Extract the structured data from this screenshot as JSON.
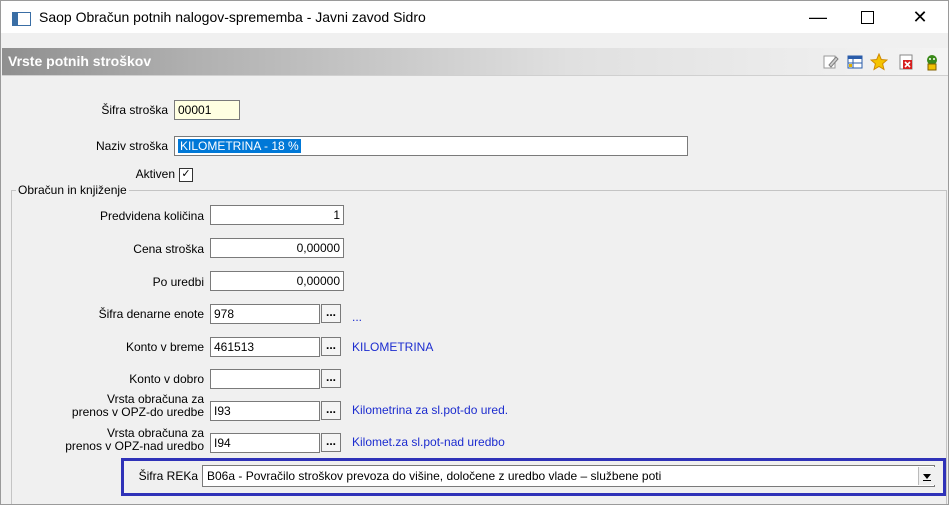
{
  "window": {
    "title": "Saop Obračun potnih nalogov-sprememba - Javni zavod Sidro",
    "min_glyph": "—",
    "close_glyph": "✕"
  },
  "header": {
    "title": "Vrste potnih stroškov",
    "toolbar_icons": [
      "edit-icon",
      "table-icon",
      "star-icon",
      "delete-icon",
      "exit-icon"
    ]
  },
  "form": {
    "sifra_label": "Šifra stroška",
    "sifra_value": "00001",
    "naziv_label": "Naziv stroška",
    "naziv_value": "KILOMETRINA - 18 %",
    "aktiven_label": "Aktiven",
    "aktiven_checked": true,
    "group_label": "Obračun in knjiženje",
    "kolicina_label": "Predvidena količina",
    "kolicina_value": "1",
    "cena_label": "Cena stroška",
    "cena_value": "0,00000",
    "po_uredbi_label": "Po uredbi",
    "po_uredbi_value": "0,00000",
    "denarna_label": "Šifra denarne enote",
    "denarna_value": "978",
    "denarna_desc": "...",
    "breme_label": "Konto v breme",
    "breme_value": "461513",
    "breme_desc": "KILOMETRINA",
    "dobro_label": "Konto v dobro",
    "dobro_value": "",
    "opz_do_label_1": "Vrsta obračuna za",
    "opz_do_label_2": "prenos v OPZ-do uredbe",
    "opz_do_value": "I93",
    "opz_do_desc": "Kilometrina za sl.pot-do ured.",
    "opz_nad_label_1": "Vrsta obračuna za",
    "opz_nad_label_2": "prenos v OPZ-nad uredbo",
    "opz_nad_value": "I94",
    "opz_nad_desc": "Kilomet.za sl.pot-nad uredbo",
    "rek_label": "Šifra REKa",
    "rek_value": "B06a - Povračilo stroškov prevoza do višine, določene z uredbo vlade – službene poti",
    "lookup_glyph": "..."
  },
  "colors": {
    "link": "#1c2ccf",
    "highlight_frame": "#2f32b8",
    "selection": "#0078d7",
    "code_field_bg": "#ffffe1"
  }
}
